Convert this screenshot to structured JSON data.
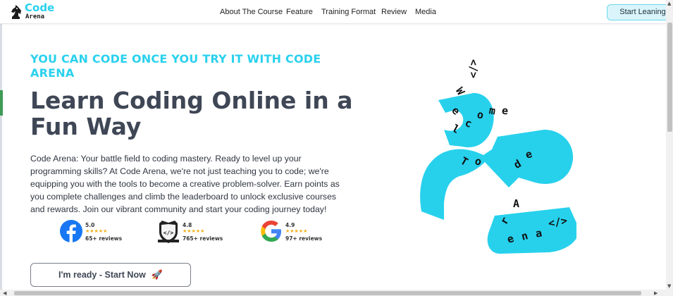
{
  "header": {
    "logo_code": "Code",
    "logo_arena": "Arena",
    "nav": [
      "About The Course",
      "Feature",
      "Training Format",
      "Review",
      "Media"
    ],
    "cta_label": "Start Leaning"
  },
  "hero": {
    "tagline": "YOU CAN CODE ONCE YOU TRY IT WITH CODE ARENA",
    "title": "Learn Coding Online in a Fun Way",
    "description": "Code Arena: Your battle field to coding mastery. Ready to level up your programming skills? At Code Arena, we're not just teaching you to code; we're equipping you with the tools to become a creative problem-solver. Earn points as you complete challenges and climb the leaderboard to unlock exclusive courses and rewards. Join our vibrant community and start your coding journey today!",
    "cta_label": "I'm ready - Start Now",
    "cta_icon": "rocket-icon"
  },
  "ratings": [
    {
      "platform_icon": "facebook-icon",
      "score": "5.0",
      "stars": "★★★★★",
      "count": "65+ reviews"
    },
    {
      "platform_icon": "code-arena-shield-icon",
      "score": "4.8",
      "stars": "★★★★★",
      "count": "765+ reviews"
    },
    {
      "platform_icon": "google-icon",
      "score": "4.9",
      "stars": "★★★★★",
      "count": "97+ reviews"
    }
  ],
  "art": {
    "glyphs": [
      "</>",
      "W",
      "e",
      "l",
      "c",
      "o",
      "m",
      "e",
      "T",
      "o",
      "d",
      "e",
      "A",
      "r",
      "e",
      "n",
      "a",
      "</>"
    ],
    "shape_color": "#27d1ec"
  },
  "colors": {
    "accent": "#2ad1ee",
    "title": "#3f4756",
    "star": "#f2b01e"
  }
}
